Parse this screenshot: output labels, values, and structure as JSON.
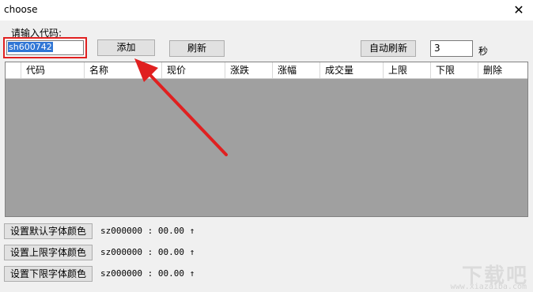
{
  "window": {
    "title": "choose",
    "close_icon": "close-icon"
  },
  "toolbar": {
    "prompt_label": "请输入代码:",
    "code_value": "sh600742",
    "add_label": "添加",
    "refresh_label": "刷新",
    "auto_refresh_label": "自动刷新",
    "interval_value": "3",
    "interval_unit": "秒"
  },
  "table": {
    "columns": [
      "代码",
      "名称",
      "现价",
      "涨跌",
      "涨幅",
      "成交量",
      "上限",
      "下限",
      "删除"
    ]
  },
  "color_settings": [
    {
      "button_label": "设置默认字体颜色",
      "status": "sz000000 : 00.00 ↑"
    },
    {
      "button_label": "设置上限字体颜色",
      "status": "sz000000 : 00.00 ↑"
    },
    {
      "button_label": "设置下限字体颜色",
      "status": "sz000000 : 00.00 ↑"
    }
  ],
  "annotation": {
    "arrow_color": "#e02020",
    "highlight_color": "#e02020"
  },
  "watermark": {
    "text": "下载吧",
    "url": "www.xiazaiba.com"
  }
}
